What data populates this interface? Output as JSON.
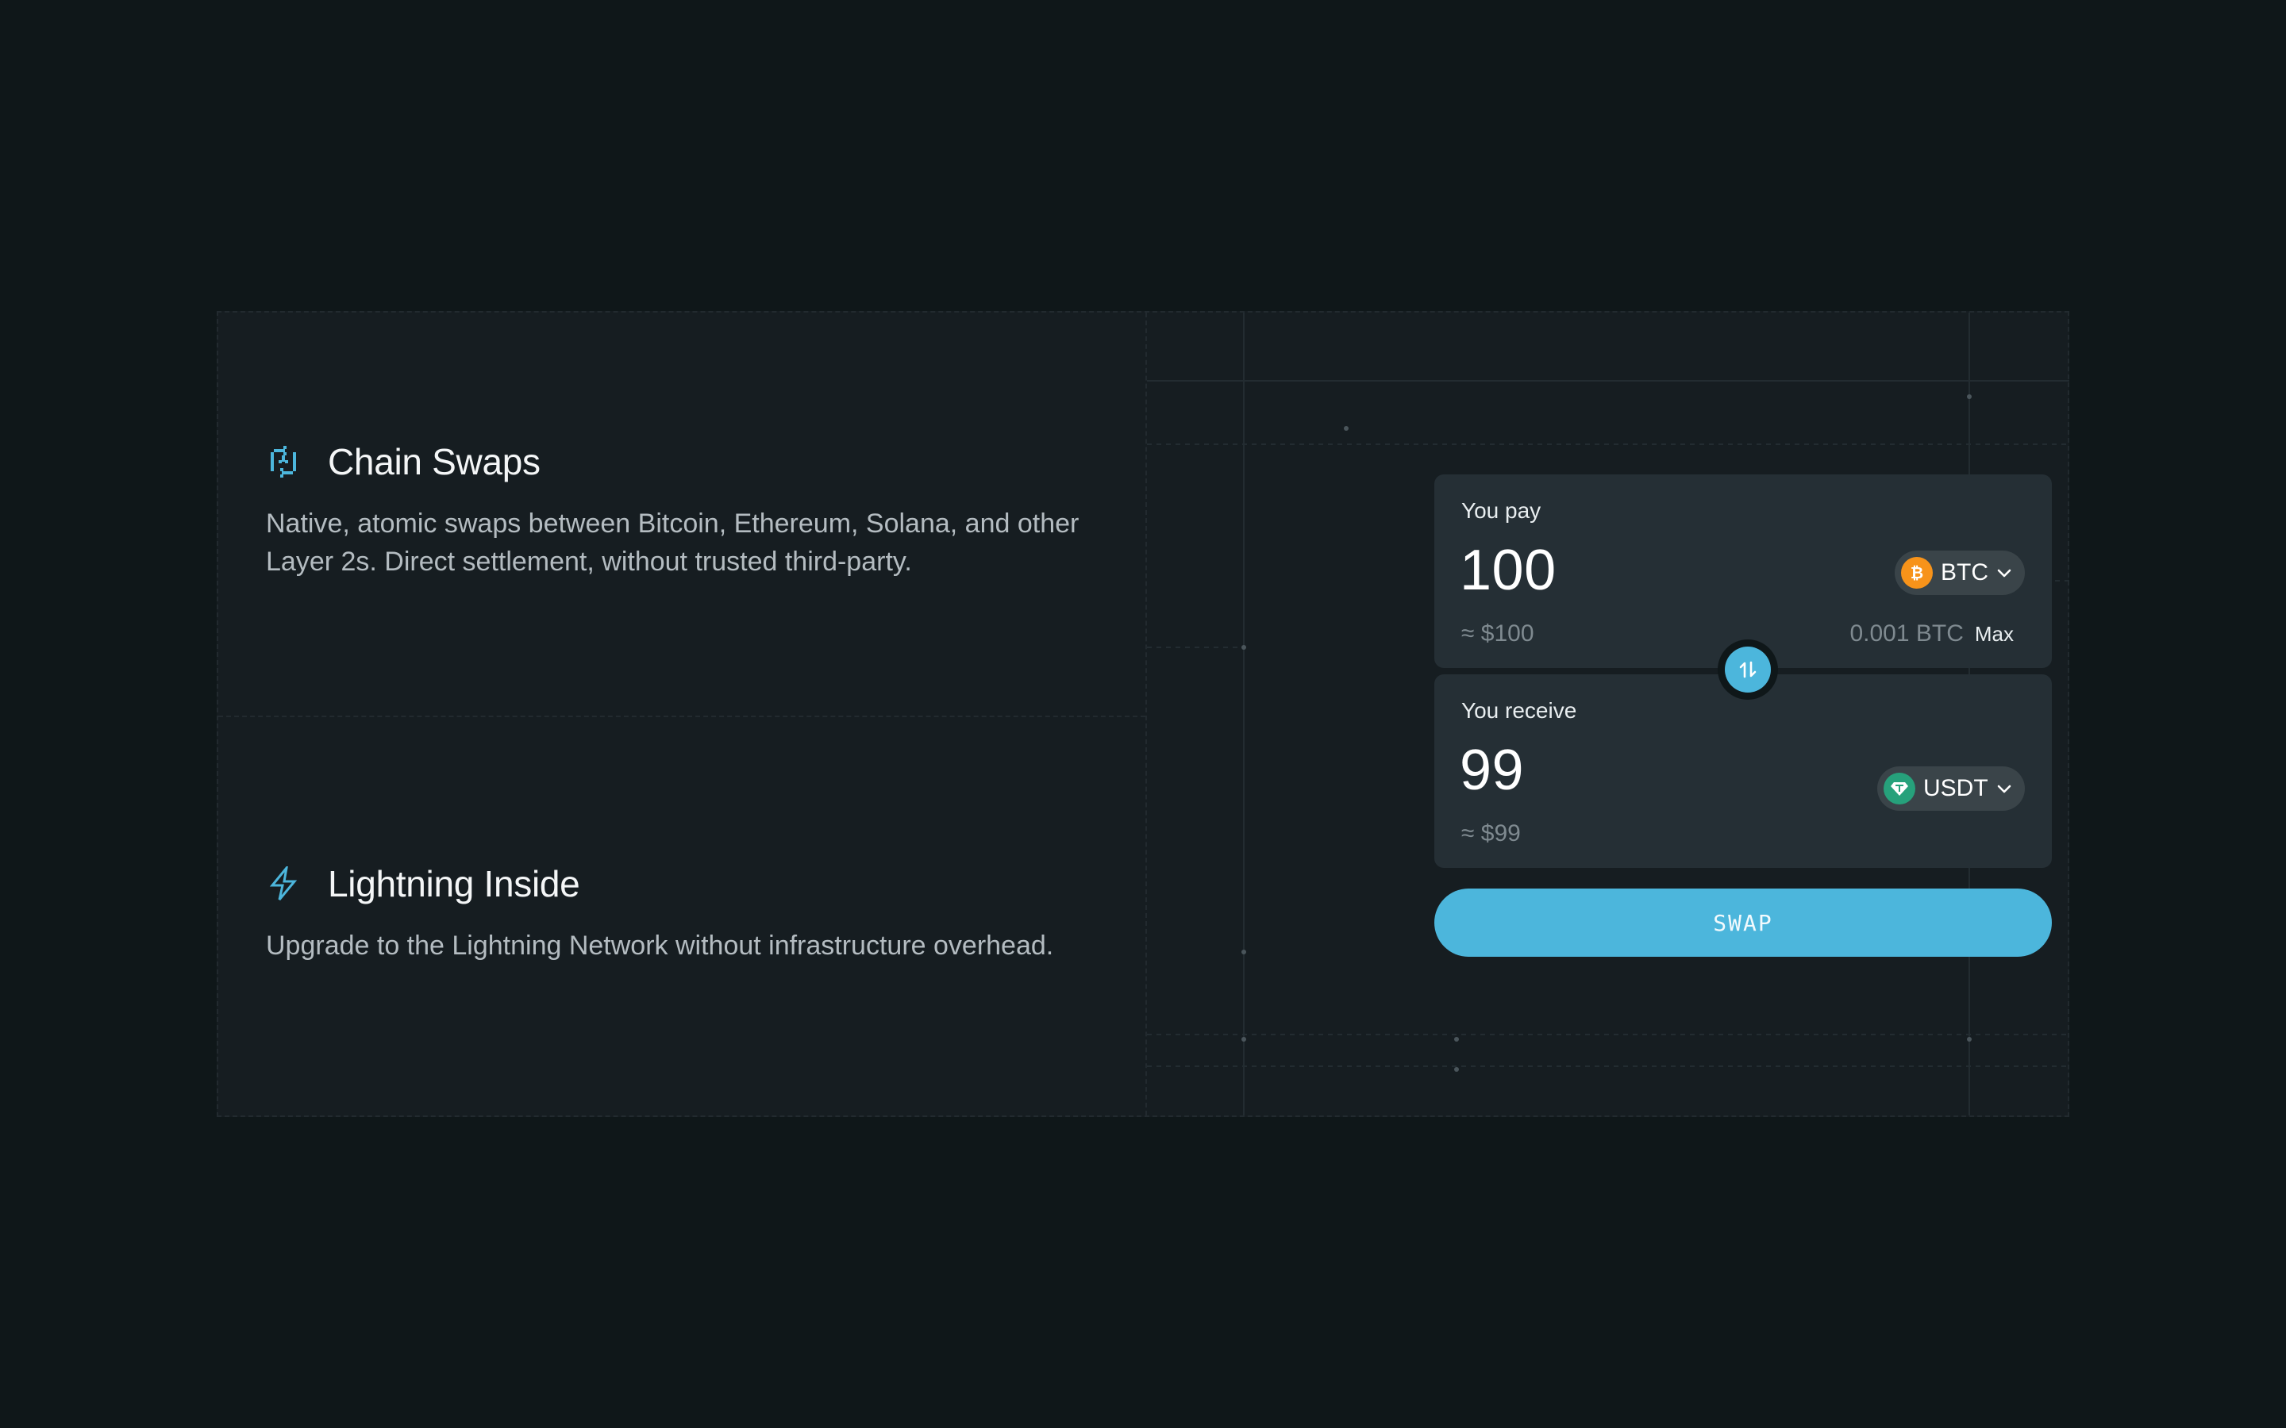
{
  "features": [
    {
      "icon": "chain-swap-icon",
      "title": "Chain Swaps",
      "description": "Native, atomic swaps between Bitcoin, Ethereum, Solana, and other Layer 2s. Direct settlement, without trusted third-party."
    },
    {
      "icon": "lightning-icon",
      "title": "Lightning Inside",
      "description": "Upgrade to the Lightning Network without infrastructure overhead."
    }
  ],
  "swap": {
    "pay": {
      "label": "You pay",
      "amount": "100",
      "fiat": "≈ $100",
      "token": "BTC",
      "token_icon": "bitcoin-icon",
      "balance": "0.001 BTC",
      "max_label": "Max"
    },
    "receive": {
      "label": "You receive",
      "amount": "99",
      "fiat": "≈ $99",
      "token": "USDT",
      "token_icon": "tether-icon"
    },
    "button_label": "SWAP"
  },
  "colors": {
    "background": "#0f1719",
    "panel": "#161d21",
    "card": "#252f35",
    "accent": "#4cb6dc",
    "btc": "#f7931a",
    "usdt": "#26a17b"
  }
}
